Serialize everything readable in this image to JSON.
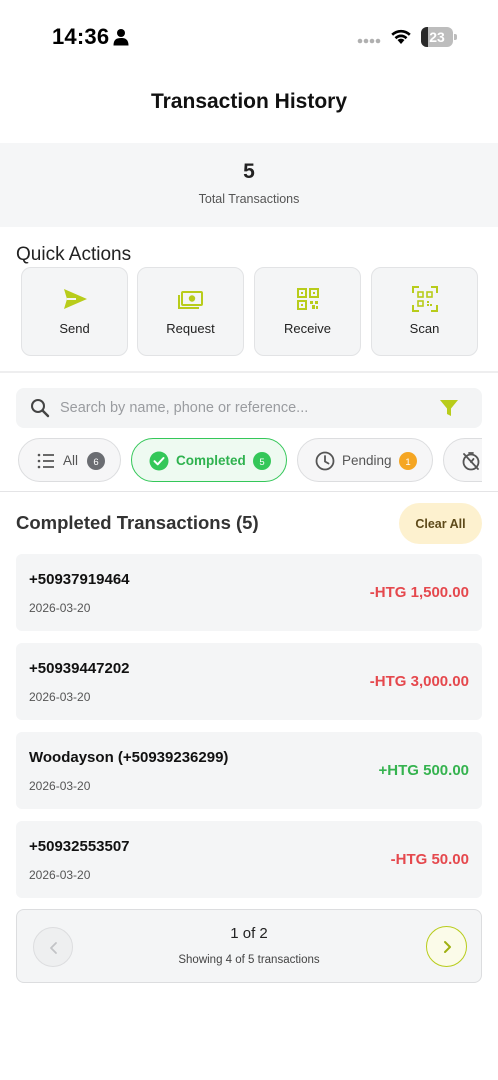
{
  "status_bar": {
    "time": "14:36",
    "battery": "23",
    "battery_level": 0.23
  },
  "header": {
    "title": "Transaction History"
  },
  "summary": {
    "count": "5",
    "label": "Total Transactions"
  },
  "quick_actions": {
    "title": "Quick Actions",
    "items": [
      {
        "label": "Send",
        "icon": "send-icon"
      },
      {
        "label": "Request",
        "icon": "cash-icon"
      },
      {
        "label": "Receive",
        "icon": "qr-code-icon"
      },
      {
        "label": "Scan",
        "icon": "scan-icon"
      }
    ]
  },
  "search": {
    "placeholder": "Search by name, phone or reference...",
    "value": ""
  },
  "tabs": [
    {
      "label": "All",
      "badge": "6",
      "icon": "list-icon",
      "active": false
    },
    {
      "label": "Completed",
      "badge": "5",
      "icon": "check-circle-icon",
      "active": true
    },
    {
      "label": "Pending",
      "badge": "1",
      "icon": "clock-icon",
      "active": false
    },
    {
      "label": "",
      "badge": "",
      "icon": "timer-off-icon",
      "active": false
    }
  ],
  "list": {
    "title": "Completed Transactions (5)",
    "clear_label": "Clear All",
    "items": [
      {
        "name": "+50937919464",
        "date": "2026-03-20",
        "amount": "-HTG 1,500.00",
        "direction": "out"
      },
      {
        "name": "+50939447202",
        "date": "2026-03-20",
        "amount": "-HTG 3,000.00",
        "direction": "out"
      },
      {
        "name": "Woodayson (+50939236299)",
        "date": "2026-03-20",
        "amount": "+HTG 500.00",
        "direction": "in"
      },
      {
        "name": "+50932553507",
        "date": "2026-03-20",
        "amount": "-HTG 50.00",
        "direction": "out"
      }
    ]
  },
  "pagination": {
    "page": "1 of 2",
    "info": "Showing 4 of 5 transactions"
  },
  "colors": {
    "accent": "#b8cc1b",
    "success": "#34c759",
    "danger": "#e5484d",
    "pending": "#f5a623",
    "clear_bg": "#fdf1cf"
  }
}
